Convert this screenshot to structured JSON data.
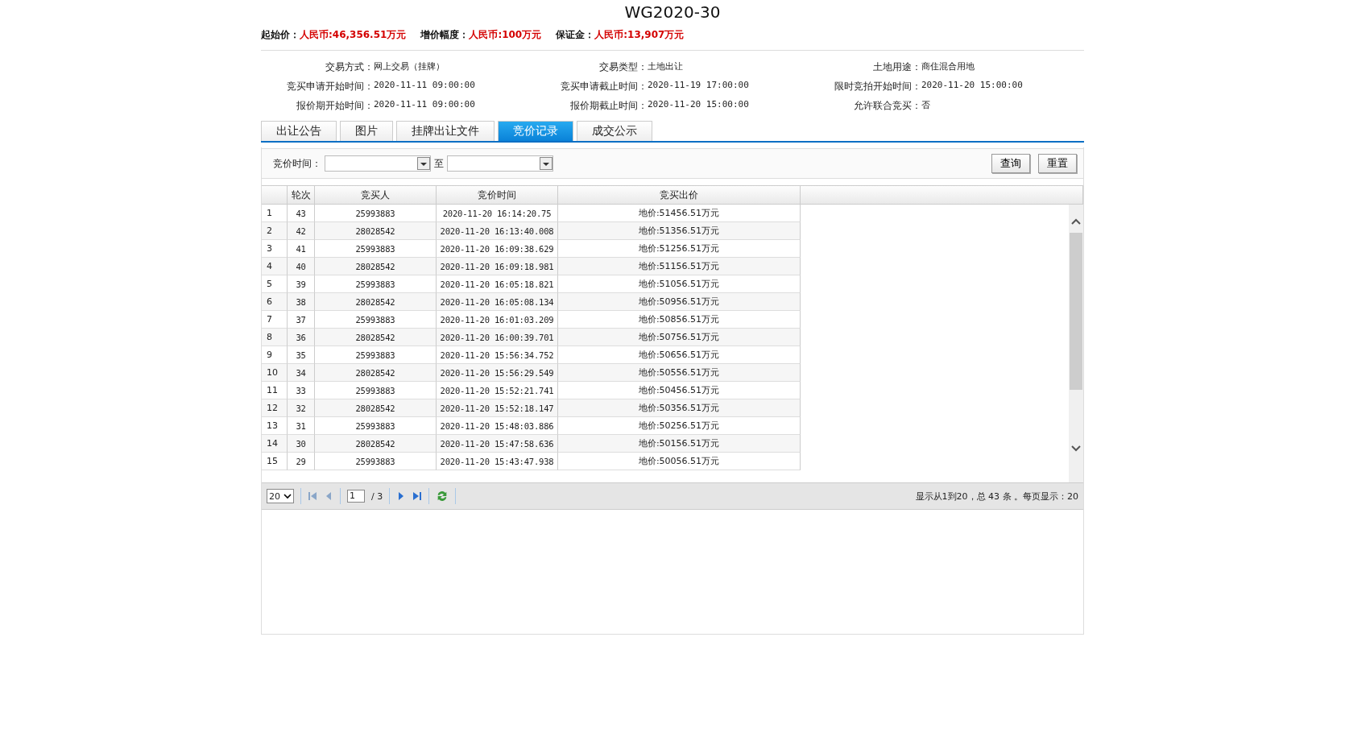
{
  "title": "WG2020-30",
  "prices": [
    {
      "label": "起始价：",
      "value": "人民币:46,356.51万元"
    },
    {
      "label": "增价幅度：",
      "value": "人民币:100万元"
    },
    {
      "label": "保证金：",
      "value": "人民币:13,907万元"
    }
  ],
  "info": [
    {
      "label": "交易方式：",
      "value": "网上交易（挂牌）"
    },
    {
      "label": "交易类型：",
      "value": "土地出让"
    },
    {
      "label": "土地用途：",
      "value": "商住混合用地"
    },
    {
      "label": "竞买申请开始时间：",
      "value": "2020-11-11 09:00:00"
    },
    {
      "label": "竞买申请截止时间：",
      "value": "2020-11-19 17:00:00"
    },
    {
      "label": "限时竞拍开始时间：",
      "value": "2020-11-20 15:00:00"
    },
    {
      "label": "报价期开始时间：",
      "value": "2020-11-11 09:00:00"
    },
    {
      "label": "报价期截止时间：",
      "value": "2020-11-20 15:00:00"
    },
    {
      "label": "允许联合竞买：",
      "value": "否"
    }
  ],
  "tabs": [
    {
      "label": "出让公告",
      "selected": false
    },
    {
      "label": "图片",
      "selected": false
    },
    {
      "label": "挂牌出让文件",
      "selected": false
    },
    {
      "label": "竞价记录",
      "selected": true
    },
    {
      "label": "成交公示",
      "selected": false
    }
  ],
  "filter": {
    "label": "竞价时间：",
    "separator": "至",
    "buttons": [
      "查询",
      "重置"
    ]
  },
  "table": {
    "columns": [
      "轮次",
      "竞买人",
      "竞价时间",
      "竞买出价"
    ],
    "rows": [
      {
        "index": "1",
        "cells": [
          "43",
          "25993883",
          "2020-11-20 16:14:20.75",
          "地价:51456.51万元"
        ]
      },
      {
        "index": "2",
        "cells": [
          "42",
          "28028542",
          "2020-11-20 16:13:40.008",
          "地价:51356.51万元"
        ]
      },
      {
        "index": "3",
        "cells": [
          "41",
          "25993883",
          "2020-11-20 16:09:38.629",
          "地价:51256.51万元"
        ]
      },
      {
        "index": "4",
        "cells": [
          "40",
          "28028542",
          "2020-11-20 16:09:18.981",
          "地价:51156.51万元"
        ]
      },
      {
        "index": "5",
        "cells": [
          "39",
          "25993883",
          "2020-11-20 16:05:18.821",
          "地价:51056.51万元"
        ]
      },
      {
        "index": "6",
        "cells": [
          "38",
          "28028542",
          "2020-11-20 16:05:08.134",
          "地价:50956.51万元"
        ]
      },
      {
        "index": "7",
        "cells": [
          "37",
          "25993883",
          "2020-11-20 16:01:03.209",
          "地价:50856.51万元"
        ]
      },
      {
        "index": "8",
        "cells": [
          "36",
          "28028542",
          "2020-11-20 16:00:39.701",
          "地价:50756.51万元"
        ]
      },
      {
        "index": "9",
        "cells": [
          "35",
          "25993883",
          "2020-11-20 15:56:34.752",
          "地价:50656.51万元"
        ]
      },
      {
        "index": "10",
        "cells": [
          "34",
          "28028542",
          "2020-11-20 15:56:29.549",
          "地价:50556.51万元"
        ]
      },
      {
        "index": "11",
        "cells": [
          "33",
          "25993883",
          "2020-11-20 15:52:21.741",
          "地价:50456.51万元"
        ]
      },
      {
        "index": "12",
        "cells": [
          "32",
          "28028542",
          "2020-11-20 15:52:18.147",
          "地价:50356.51万元"
        ]
      },
      {
        "index": "13",
        "cells": [
          "31",
          "25993883",
          "2020-11-20 15:48:03.886",
          "地价:50256.51万元"
        ]
      },
      {
        "index": "14",
        "cells": [
          "30",
          "28028542",
          "2020-11-20 15:47:58.636",
          "地价:50156.51万元"
        ]
      },
      {
        "index": "15",
        "cells": [
          "29",
          "25993883",
          "2020-11-20 15:43:47.938",
          "地价:50056.51万元"
        ]
      }
    ]
  },
  "pager": {
    "page_size": "20",
    "page": "1",
    "total_pages": "/ 3",
    "status": "显示从1到20，总 43 条 。每页显示：20"
  }
}
